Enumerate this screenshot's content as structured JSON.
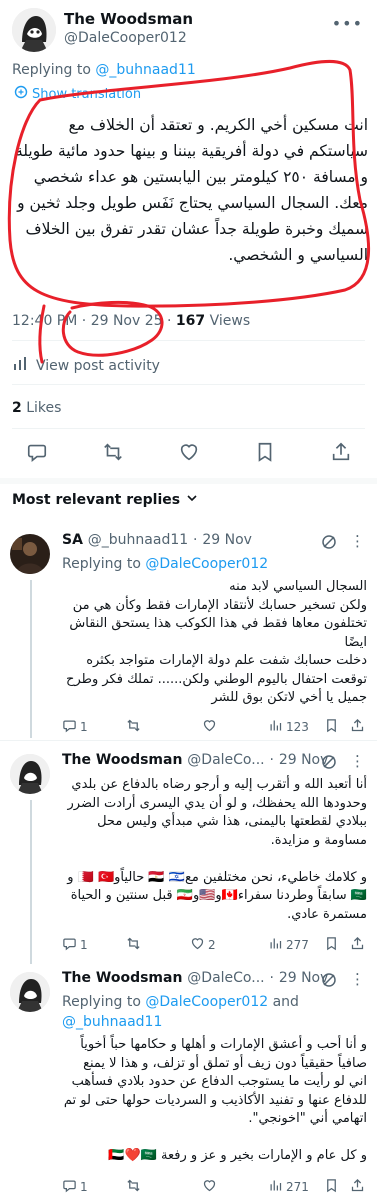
{
  "post": {
    "author_name": "The Woodsman",
    "author_handle": "@DaleCooper012",
    "replying_prefix": "Replying to ",
    "replying_handle": "@_buhnaad11",
    "show_translation": "Show translation",
    "body": "انت مسكين أخي الكريم. و تعتقد أن الخلاف مع سياستكم في دولة أفريقية بيننا و بينها حدود مائية طويلة و مسافة ٢٥٠ كيلومتر بين اليابستين هو عداء شخصي معك. السجال السياسي يحتاج نَفَس طويل وجلد ثخين و سميك وخبرة طويلة جداً عشان تقدر تفرق بين الخلاف السياسي و الشخصي.",
    "time": "12:40 PM",
    "dot": "·",
    "date": "29 Nov 25",
    "views_count": "167",
    "views_label": "Views",
    "post_activity": "View post activity",
    "likes_count": "2",
    "likes_label": "Likes"
  },
  "replies_header": "Most relevant replies",
  "replies": [
    {
      "name": "SA",
      "handle": "@_buhnaad11",
      "dot": "·",
      "date": "29 Nov",
      "replying_prefix": "Replying to ",
      "replying_handle": "@DaleCooper012",
      "text": "السجال السياسي لابد منه\nولكن تسخير حسابك لأنتقاد الإمارات فقط وكأن هي من تختلفون معاها فقط في هذا الكوكب هذا يستحق النقاش ايضًا\nدخلت حسابك شفت علم دولة الإمارات متواجد بكثره توقعت احتفال باليوم الوطني ولكن...... تملك فكر وطرح جميل يا أخي لاتكن بوق للشر",
      "replies": "1",
      "retweets": "",
      "likes": "",
      "views": "123"
    },
    {
      "name": "The Woodsman",
      "handle": "@DaleCo...",
      "dot": "·",
      "date": "29 Nov",
      "text": "أنا أتعبد الله و أتقرب إليه و أرجو رضاه بالدفاع عن بلدي وحدودها الله يحفظك، و لو أن يدي اليسرى أرادت الضرر ببلادي لقطعتها باليمنى، هذا شي مبدأي وليس محل مساومة و مزايدة.\n\nو كلامك خاطيء، نحن مختلفين مع🇪🇬 🇮🇱 حالياًو🇧🇭 🇹🇷 و🇸🇦 سابقاً وطردنا سفراء🇨🇦و🇺🇸و🇮🇷 قبل سنتين و الحياة مستمرة عادي.",
      "replies": "1",
      "retweets": "",
      "likes": "2",
      "views": "277"
    },
    {
      "name": "The Woodsman",
      "handle": "@DaleCo...",
      "dot": "·",
      "date": "29 Nov",
      "replying_prefix": "Replying to ",
      "replying_handle": "@DaleCooper012",
      "replying_and": " and",
      "replying_handle2": "@_buhnaad11",
      "text": "و أنا أحب و أعشق الإمارات و أهلها و حكامها حباً أخوياً صافياً حقيقياً دون زيف أو تملق أو تزلف، و هذا لا يمنع اني لو رأيت ما يستوجب الدفاع عن حدود بلادي فسأهب للدفاع عنها و تفنيد الأكاذيب و السرديات حولها حتى لو تم اتهامي أني \"اخونجي\".\n\nو كل عام و الإمارات بخير و عز و رفعة 🇦🇪❤️🇸🇦",
      "replies": "1",
      "retweets": "",
      "likes": "",
      "views": "271"
    }
  ],
  "colors": {
    "accent": "#1d9bf0",
    "muted": "#536471",
    "annotation": "#e8202a"
  },
  "icons": [
    "more-icon",
    "translate-icon",
    "activity-icon",
    "reply-icon",
    "retweet-icon",
    "like-icon",
    "bookmark-icon",
    "share-icon",
    "views-icon",
    "grok-icon"
  ]
}
